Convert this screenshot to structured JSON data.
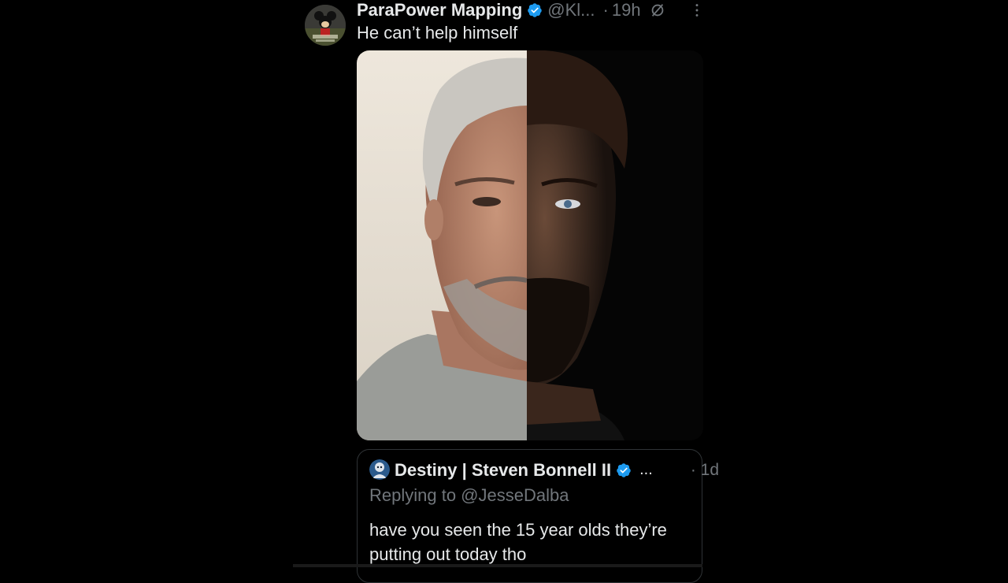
{
  "post": {
    "display_name": "ParaPower Mapping",
    "handle": "@Kl...",
    "separator": "·",
    "time": "19h",
    "text": "He can’t help himself",
    "avatar_icon": "mickey-mouse-avatar",
    "verified_icon": "verified-badge-icon",
    "menu_icon": "more-options-icon"
  },
  "media": {
    "description_icon": "split-face-photo"
  },
  "quote": {
    "display_name": "Destiny | Steven Bonnell II",
    "ellipsis": "...",
    "time": "· 1d",
    "reply_prefix": "Replying to @JesseDalba",
    "text": "have you seen the 15 year olds they’re putting out today tho"
  },
  "colors": {
    "background": "#000000",
    "text_primary": "#e7e9ea",
    "text_secondary": "#71767b",
    "verified_blue": "#1d9bf0",
    "border": "#2f3336"
  }
}
